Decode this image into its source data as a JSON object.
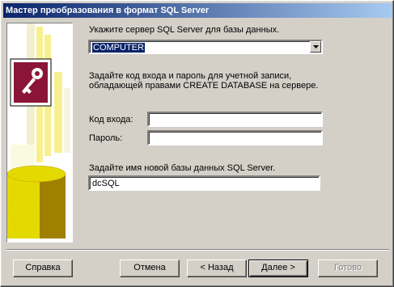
{
  "window": {
    "title": "Мастер преобразования в формат SQL Server"
  },
  "server": {
    "prompt": "Укажите сервер SQL Server для базы данных.",
    "value": "COMPUTER"
  },
  "login_section": {
    "prompt_line1": "Задайте код входа и пароль для учетной записи,",
    "prompt_line2": "обладающей правами CREATE DATABASE на сервере.",
    "login_label": "Код входа:",
    "login_value": "",
    "password_label": "Пароль:",
    "password_value": ""
  },
  "database": {
    "prompt": "Задайте имя новой базы данных SQL Server.",
    "value": "dcSQL"
  },
  "buttons": {
    "help": "Справка",
    "cancel": "Отмена",
    "back": "< Назад",
    "next": "Далее >",
    "finish": "Готово"
  },
  "icons": {
    "illustration": "access-key-icon",
    "dropdown": "chevron-down-icon"
  },
  "colors": {
    "titlebar_start": "#0a246a",
    "titlebar_end": "#a6caf0",
    "access_maroon": "#8b1538",
    "dialog_bg": "#d4d0c8"
  }
}
